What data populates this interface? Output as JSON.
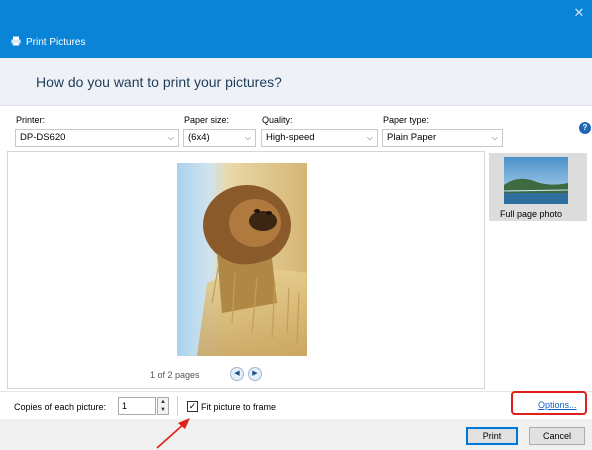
{
  "window": {
    "title": "Print Pictures",
    "close_glyph": "✕"
  },
  "header": {
    "question": "How do you want to print your pictures?"
  },
  "fields": {
    "printer": {
      "label": "Printer:",
      "value": "DP-DS620"
    },
    "paper_size": {
      "label": "Paper size:",
      "value": "(6x4)"
    },
    "quality": {
      "label": "Quality:",
      "value": "High-speed"
    },
    "paper_type": {
      "label": "Paper type:",
      "value": "Plain Paper"
    },
    "dropdown_icon": "chevron-down-icon",
    "help_glyph": "?"
  },
  "preview": {
    "pager_text": "1 of 2 pages",
    "prev_glyph": "◀",
    "next_glyph": "▶"
  },
  "layouts": {
    "items": [
      {
        "label": "Full page photo"
      }
    ]
  },
  "copies": {
    "label": "Copies of each picture:",
    "value": "1",
    "up_glyph": "▲",
    "down_glyph": "▼"
  },
  "fit": {
    "label": "Fit picture to frame",
    "checked_glyph": "✓",
    "checked": true
  },
  "options": {
    "link_text": "Options..."
  },
  "actions": {
    "print_label": "Print",
    "cancel_label": "Cancel"
  },
  "colors": {
    "titlebar": "#0a84d6",
    "annotation_red": "#e0201b",
    "link": "#1460c4"
  }
}
